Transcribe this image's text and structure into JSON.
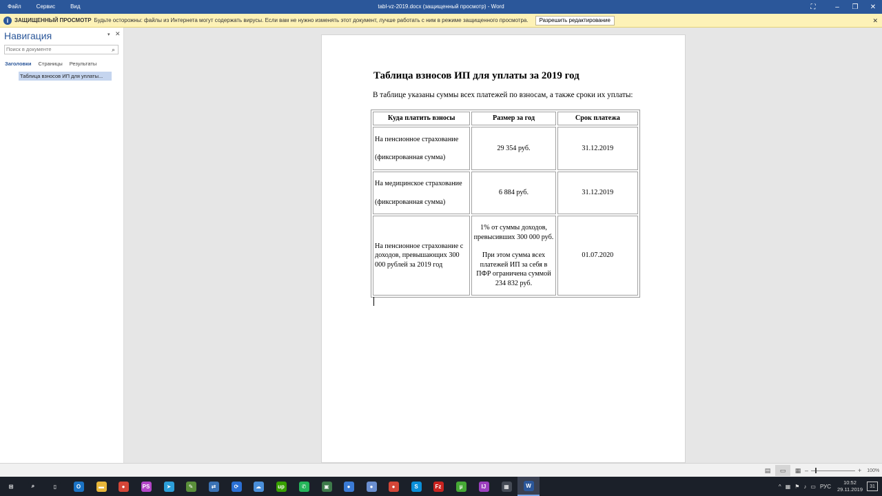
{
  "titlebar": {
    "menu": [
      "Файл",
      "Сервис",
      "Вид"
    ],
    "title": "tabl-vz-2019.docx (защищенный просмотр) - Word",
    "controls": {
      "focus": "⛶",
      "minimize": "–",
      "restore": "❐",
      "close": "✕"
    }
  },
  "protected_view": {
    "icon": "i",
    "label": "ЗАЩИЩЕННЫЙ ПРОСМОТР",
    "message": "Будьте осторожны: файлы из Интернета могут содержать вирусы. Если вам не нужно изменять этот документ, лучше работать с ним в режиме защищенного просмотра.",
    "button": "Разрешить редактирование",
    "close": "✕"
  },
  "navigation": {
    "title": "Навигация",
    "pin": "▾",
    "close": "✕",
    "search_placeholder": "Поиск в документе",
    "search_icon": "⌕",
    "tabs": [
      "Заголовки",
      "Страницы",
      "Результаты"
    ],
    "active_tab": "Заголовки",
    "headings": [
      "Таблица взносов ИП для уплаты..."
    ]
  },
  "document": {
    "title": "Таблица взносов ИП для уплаты за 2019 год",
    "intro": "В таблице указаны суммы всех платежей по взносам, а также сроки их уплаты:",
    "table": {
      "headers": [
        "Куда платить взносы",
        "Размер за год",
        "Срок платежа"
      ],
      "rows": [
        {
          "where": [
            "На пенсионное страхование",
            "(фиксированная сумма)"
          ],
          "amount": [
            "29 354 руб."
          ],
          "deadline": "31.12.2019"
        },
        {
          "where": [
            "На медицинское страхование",
            "(фиксированная сумма)"
          ],
          "amount": [
            "6 884 руб."
          ],
          "deadline": "31.12.2019"
        },
        {
          "where": [
            "На пенсионное страхование с доходов, превышающих 300 000 рублей за 2019 год"
          ],
          "amount": [
            "1% от суммы доходов, превысивших 300 000 руб.",
            "При этом сумма всех платежей ИП за себя в ПФР ограничена суммой 234 832 руб."
          ],
          "deadline": "01.07.2020"
        }
      ]
    }
  },
  "statusbar": {
    "zoom": "100%",
    "zoom_minus": "–",
    "zoom_plus": "+"
  },
  "taskbar": {
    "items": [
      {
        "name": "start-icon",
        "glyph": "⊞",
        "color": "#1b2029"
      },
      {
        "name": "search-icon",
        "glyph": "⌕",
        "color": "#1b2029"
      },
      {
        "name": "task-view-icon",
        "glyph": "▯",
        "color": "#1b2029"
      },
      {
        "name": "outlook-icon",
        "glyph": "O",
        "color": "#1a73c4"
      },
      {
        "name": "explorer-icon",
        "glyph": "▬",
        "color": "#e8b73a"
      },
      {
        "name": "chrome-icon",
        "glyph": "●",
        "color": "#d44638"
      },
      {
        "name": "phpstorm-icon",
        "glyph": "PS",
        "color": "#b345c7"
      },
      {
        "name": "telegram-icon",
        "glyph": "➤",
        "color": "#2c9fd9"
      },
      {
        "name": "notepad-icon",
        "glyph": "✎",
        "color": "#5a8f3a"
      },
      {
        "name": "network-icon",
        "glyph": "⇄",
        "color": "#3a72b5"
      },
      {
        "name": "sync-icon",
        "glyph": "⟳",
        "color": "#2a6fd4"
      },
      {
        "name": "cloud-icon",
        "glyph": "☁",
        "color": "#4a8fd9"
      },
      {
        "name": "upwork-icon",
        "glyph": "up",
        "color": "#37a000"
      },
      {
        "name": "whatsapp-icon",
        "glyph": "✆",
        "color": "#25b55a"
      },
      {
        "name": "terminal-icon",
        "glyph": "▣",
        "color": "#3d7a4a"
      },
      {
        "name": "chrome-icon-2",
        "glyph": "●",
        "color": "#3a7bd5"
      },
      {
        "name": "chrome-icon-3",
        "glyph": "●",
        "color": "#6a8fd0"
      },
      {
        "name": "chrome-icon-4",
        "glyph": "●",
        "color": "#d44638"
      },
      {
        "name": "skype-icon",
        "glyph": "S",
        "color": "#0a8fd8"
      },
      {
        "name": "filezilla-icon",
        "glyph": "Fz",
        "color": "#c8231f"
      },
      {
        "name": "utorrent-icon",
        "glyph": "µ",
        "color": "#46a935"
      },
      {
        "name": "intellij-icon",
        "glyph": "IJ",
        "color": "#9c3fbf"
      },
      {
        "name": "calculator-icon",
        "glyph": "▦",
        "color": "#444a55"
      },
      {
        "name": "word-icon",
        "glyph": "W",
        "color": "#2b579a"
      }
    ],
    "tray": {
      "chevron": "^",
      "lang": "РУС",
      "time": "10:52",
      "date": "29.11.2019",
      "notifications": "31"
    }
  }
}
